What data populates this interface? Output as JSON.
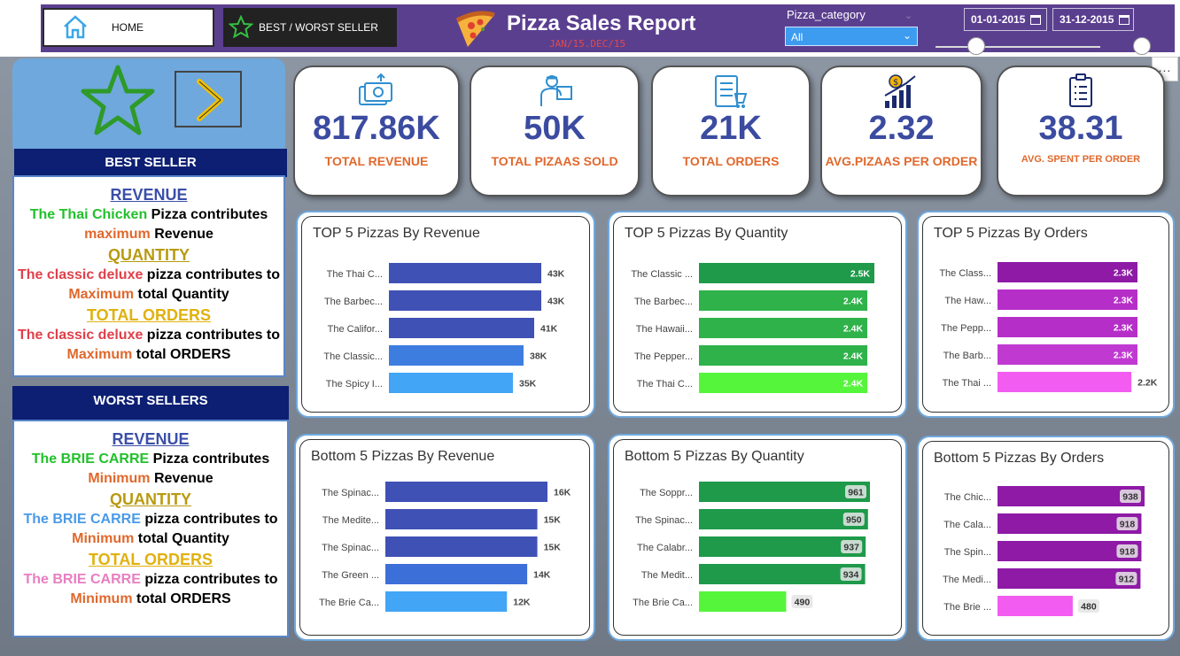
{
  "nav": {
    "home_label": "HOME",
    "best_worst_label": "BEST / WORST SELLER"
  },
  "header": {
    "title": "Pizza Sales Report",
    "subtitle": "JAN/15.DEC/15",
    "category_label": "Pizza_category",
    "category_value": "All",
    "date_start": "01-01-2015",
    "date_end": "31-12-2015"
  },
  "more_label": "...",
  "kpis": [
    {
      "value": "817.86K",
      "label": "TOTAL REVENUE",
      "icon": "money-transfer-icon"
    },
    {
      "value": "50K",
      "label": "TOTAL PIZAAS SOLD",
      "icon": "delivery-person-icon"
    },
    {
      "value": "21K",
      "label": "TOTAL ORDERS",
      "icon": "order-list-icon"
    },
    {
      "value": "2.32",
      "label": "AVG.PIZAAS PER ORDER",
      "icon": "growth-chart-icon"
    },
    {
      "value": "38.31",
      "label": "AVG. SPENT PER ORDER",
      "icon": "clipboard-icon"
    }
  ],
  "best": {
    "heading": "BEST SELLER",
    "revenue_title": "REVENUE",
    "revenue_pizza": "The Thai Chicken",
    "revenue_text1": " Pizza contributes",
    "revenue_word": "maximum",
    "revenue_text2": " Revenue",
    "quantity_title": " QUANTITY",
    "quantity_pizza": "The classic deluxe",
    "quantity_text1": " pizza contributes to",
    "quantity_word": "Maximum",
    "quantity_text2": " total Quantity",
    "orders_title": "TOTAL ORDERS ",
    "orders_pizza": "The classic deluxe",
    "orders_text1": " pizza contributes to",
    "orders_word": "Maximum",
    "orders_text2": " total ORDERS"
  },
  "worst": {
    "heading": "WORST SELLERS",
    "revenue_title": "REVENUE",
    "revenue_pizza": "The BRIE CARRE",
    "revenue_text1": " Pizza contributes",
    "revenue_word": "Minimum",
    "revenue_text2": " Revenue",
    "quantity_title": " QUANTITY",
    "quantity_pizza": "The BRIE CARRE",
    "quantity_text1": " pizza contributes to",
    "quantity_word": "Minimum",
    "quantity_text2": " total Quantity",
    "orders_title": "TOTAL ORDERS ",
    "orders_pizza": "The BRIE CARRE",
    "orders_text1": " pizza contributes to",
    "orders_word": "Minimum",
    "orders_text2": " total ORDERS"
  },
  "chart_data": [
    {
      "type": "bar",
      "orientation": "horizontal",
      "title": "TOP 5 Pizzas By Revenue",
      "categories": [
        "The Thai C...",
        "The Barbec...",
        "The Califor...",
        "The Classic...",
        "The Spicy I..."
      ],
      "values": [
        43000,
        43000,
        41000,
        38000,
        35000
      ],
      "labels": [
        "43K",
        "43K",
        "41K",
        "38K",
        "35K"
      ],
      "colors": [
        "#3f51b5",
        "#3f51b5",
        "#3f51b5",
        "#3d7de0",
        "#42a5f5"
      ],
      "label_inside": false
    },
    {
      "type": "bar",
      "orientation": "horizontal",
      "title": "TOP 5 Pizzas By Quantity",
      "categories": [
        "The Classic ...",
        "The Barbec...",
        "The Hawaii...",
        "The Pepper...",
        "The Thai C..."
      ],
      "values": [
        2500,
        2400,
        2400,
        2400,
        2400
      ],
      "labels": [
        "2.5K",
        "2.4K",
        "2.4K",
        "2.4K",
        "2.4K"
      ],
      "colors": [
        "#1e9a4a",
        "#2fb24a",
        "#2fb24a",
        "#2fb24a",
        "#55f53c"
      ],
      "label_inside": true
    },
    {
      "type": "bar",
      "orientation": "horizontal",
      "title": "TOP 5 Pizzas By Orders",
      "categories": [
        "The Class...",
        "The Haw...",
        "The Pepp...",
        "The Barb...",
        "The Thai ..."
      ],
      "values": [
        2300,
        2300,
        2300,
        2300,
        2200
      ],
      "labels": [
        "2.3K",
        "2.3K",
        "2.3K",
        "2.3K",
        "2.2K"
      ],
      "colors": [
        "#8e1aa6",
        "#b62ec8",
        "#b62ec8",
        "#c03ad2",
        "#f25cf0"
      ],
      "label_inside": true,
      "last_outside": true
    },
    {
      "type": "bar",
      "orientation": "horizontal",
      "title": "Bottom 5 Pizzas By Revenue",
      "categories": [
        "The Spinac...",
        "The Medite...",
        "The Spinac...",
        "The Green ...",
        "The Brie Ca..."
      ],
      "values": [
        16000,
        15000,
        15000,
        14000,
        12000
      ],
      "labels": [
        "16K",
        "15K",
        "15K",
        "14K",
        "12K"
      ],
      "colors": [
        "#3f51b5",
        "#3f51b5",
        "#3f51b5",
        "#3d6fd8",
        "#42a5f5"
      ],
      "label_inside": false
    },
    {
      "type": "bar",
      "orientation": "horizontal",
      "title": "Bottom 5 Pizzas By Quantity",
      "categories": [
        "The Soppr...",
        "The Spinac...",
        "The Calabr...",
        "The Medit...",
        "The Brie Ca..."
      ],
      "values": [
        961,
        950,
        937,
        934,
        490
      ],
      "labels": [
        "961",
        "950",
        "937",
        "934",
        "490"
      ],
      "colors": [
        "#1e9a4a",
        "#1e9a4a",
        "#1e9a4a",
        "#1e9a4a",
        "#55f53c"
      ],
      "label_inside": true,
      "badge": true
    },
    {
      "type": "bar",
      "orientation": "horizontal",
      "title": "Bottom 5 Pizzas By Orders",
      "categories": [
        "The Chic...",
        "The Cala...",
        "The Spin...",
        "The Medi...",
        "The Brie ..."
      ],
      "values": [
        938,
        918,
        918,
        912,
        480
      ],
      "labels": [
        "938",
        "918",
        "918",
        "912",
        "480"
      ],
      "colors": [
        "#8e1aa6",
        "#8e1aa6",
        "#8e1aa6",
        "#8e1aa6",
        "#f25cf0"
      ],
      "label_inside": true,
      "badge": true
    }
  ]
}
